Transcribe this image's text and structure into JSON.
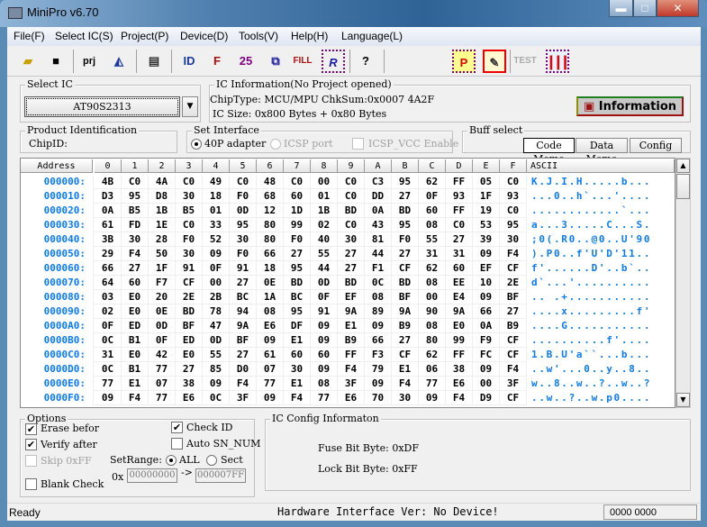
{
  "window": {
    "title": "MiniPro v6.70",
    "minimize": "▬",
    "maximize": "□",
    "close": "✕"
  },
  "menu": [
    "File(F)",
    "Select IC(S)",
    "Project(P)",
    "Device(D)",
    "Tools(V)",
    "Help(H)",
    "Language(L)"
  ],
  "toolbar": {
    "prj_label": "prj",
    "fill_label": "FILL",
    "id_label": "ID",
    "r_label": "R",
    "test_label": "TEST",
    "p_label": "P",
    "help_label": "?",
    "sig_label": "F",
    "n25_label": "25"
  },
  "select_ic": {
    "label": "Select IC",
    "value": "AT90S2313"
  },
  "ic_info": {
    "label": "IC Information(No Project opened)",
    "chip_type": "ChipType:  MCU/MPU",
    "checksum": "ChkSum:0x0007 4A2F",
    "ic_size": "IC Size:   0x800 Bytes + 0x80 Bytes",
    "button": "Information"
  },
  "product_id": {
    "label": "Product Identification",
    "chip_id": "ChipID:"
  },
  "interface": {
    "label": "Set Interface",
    "opt1": "40P adapter",
    "opt2": "ICSP port",
    "opt3": "ICSP_VCC Enable"
  },
  "buff": {
    "label": "Buff select",
    "code": "Code Memo",
    "data": "Data Memo",
    "config": "Config"
  },
  "hex": {
    "headers": [
      "Address",
      "0",
      "1",
      "2",
      "3",
      "4",
      "5",
      "6",
      "7",
      "8",
      "9",
      "A",
      "B",
      "C",
      "D",
      "E",
      "F",
      "ASCII"
    ],
    "rows": [
      {
        "addr": "000000:",
        "bytes": [
          "4B",
          "C0",
          "4A",
          "C0",
          "49",
          "C0",
          "48",
          "C0",
          "00",
          "C0",
          "C3",
          "95",
          "62",
          "FF",
          "05",
          "C0"
        ],
        "ascii": "K.J.I.H.....b..."
      },
      {
        "addr": "000010:",
        "bytes": [
          "D3",
          "95",
          "D8",
          "30",
          "18",
          "F0",
          "68",
          "60",
          "01",
          "C0",
          "DD",
          "27",
          "0F",
          "93",
          "1F",
          "93"
        ],
        "ascii": "...0..h`...'...."
      },
      {
        "addr": "000020:",
        "bytes": [
          "0A",
          "B5",
          "1B",
          "B5",
          "01",
          "0D",
          "12",
          "1D",
          "1B",
          "BD",
          "0A",
          "BD",
          "60",
          "FF",
          "19",
          "C0"
        ],
        "ascii": "............`..."
      },
      {
        "addr": "000030:",
        "bytes": [
          "61",
          "FD",
          "1E",
          "C0",
          "33",
          "95",
          "80",
          "99",
          "02",
          "C0",
          "43",
          "95",
          "08",
          "C0",
          "53",
          "95"
        ],
        "ascii": "a...3.....C...S."
      },
      {
        "addr": "000040:",
        "bytes": [
          "3B",
          "30",
          "28",
          "F0",
          "52",
          "30",
          "80",
          "F0",
          "40",
          "30",
          "81",
          "F0",
          "55",
          "27",
          "39",
          "30"
        ],
        "ascii": ";0(.R0..@0..U'90"
      },
      {
        "addr": "000050:",
        "bytes": [
          "29",
          "F4",
          "50",
          "30",
          "09",
          "F0",
          "66",
          "27",
          "55",
          "27",
          "44",
          "27",
          "31",
          "31",
          "09",
          "F4"
        ],
        "ascii": ").P0..f'U'D'11.."
      },
      {
        "addr": "000060:",
        "bytes": [
          "66",
          "27",
          "1F",
          "91",
          "0F",
          "91",
          "18",
          "95",
          "44",
          "27",
          "F1",
          "CF",
          "62",
          "60",
          "EF",
          "CF"
        ],
        "ascii": "f'......D'..b`.."
      },
      {
        "addr": "000070:",
        "bytes": [
          "64",
          "60",
          "F7",
          "CF",
          "00",
          "27",
          "0E",
          "BD",
          "0D",
          "BD",
          "0C",
          "BD",
          "08",
          "EE",
          "10",
          "2E"
        ],
        "ascii": "d`...'.........."
      },
      {
        "addr": "000080:",
        "bytes": [
          "03",
          "E0",
          "20",
          "2E",
          "2B",
          "BC",
          "1A",
          "BC",
          "0F",
          "EF",
          "08",
          "BF",
          "00",
          "E4",
          "09",
          "BF"
        ],
        "ascii": ".. .+..........."
      },
      {
        "addr": "000090:",
        "bytes": [
          "02",
          "E0",
          "0E",
          "BD",
          "78",
          "94",
          "08",
          "95",
          "91",
          "9A",
          "89",
          "9A",
          "90",
          "9A",
          "66",
          "27"
        ],
        "ascii": "....x.........f'"
      },
      {
        "addr": "0000A0:",
        "bytes": [
          "0F",
          "ED",
          "0D",
          "BF",
          "47",
          "9A",
          "E6",
          "DF",
          "09",
          "E1",
          "09",
          "B9",
          "08",
          "E0",
          "0A",
          "B9"
        ],
        "ascii": "....G..........."
      },
      {
        "addr": "0000B0:",
        "bytes": [
          "0C",
          "B1",
          "0F",
          "ED",
          "0D",
          "BF",
          "09",
          "E1",
          "09",
          "B9",
          "66",
          "27",
          "80",
          "99",
          "F9",
          "CF"
        ],
        "ascii": "..........f'...."
      },
      {
        "addr": "0000C0:",
        "bytes": [
          "31",
          "E0",
          "42",
          "E0",
          "55",
          "27",
          "61",
          "60",
          "60",
          "FF",
          "F3",
          "CF",
          "62",
          "FF",
          "FC",
          "CF"
        ],
        "ascii": "1.B.U'a``...b..."
      },
      {
        "addr": "0000D0:",
        "bytes": [
          "0C",
          "B1",
          "77",
          "27",
          "85",
          "D0",
          "07",
          "30",
          "09",
          "F4",
          "79",
          "E1",
          "06",
          "38",
          "09",
          "F4"
        ],
        "ascii": "..w'...0..y..8.."
      },
      {
        "addr": "0000E0:",
        "bytes": [
          "77",
          "E1",
          "07",
          "38",
          "09",
          "F4",
          "77",
          "E1",
          "08",
          "3F",
          "09",
          "F4",
          "77",
          "E6",
          "00",
          "3F"
        ],
        "ascii": "w..8..w..?..w..?"
      },
      {
        "addr": "0000F0:",
        "bytes": [
          "09",
          "F4",
          "77",
          "E6",
          "0C",
          "3F",
          "09",
          "F4",
          "77",
          "E6",
          "70",
          "30",
          "09",
          "F4",
          "D9",
          "CF"
        ],
        "ascii": "..w..?..w.p0...."
      }
    ]
  },
  "options": {
    "label": "Options",
    "erase": "Erase befor",
    "verify": "Verify after",
    "skip": "Skip 0xFF",
    "blank": "Blank Check",
    "check_id": "Check ID",
    "auto_sn": "Auto SN_NUM",
    "set_range": "SetRange:",
    "all": "ALL",
    "sect": "Sect",
    "ox": "0x",
    "from": "00000000",
    "arrow": "->",
    "to": "000007FF",
    "erase_checked": true,
    "verify_checked": true,
    "check_id_checked": true
  },
  "config": {
    "label": "IC Config Informaton",
    "fuse": "Fuse Bit Byte: 0xDF",
    "lock": "Lock Bit Byte: 0xFF"
  },
  "status": {
    "ready": "Ready",
    "hardware": "Hardware Interface Ver: No Device!",
    "counter": "0000 0000"
  }
}
